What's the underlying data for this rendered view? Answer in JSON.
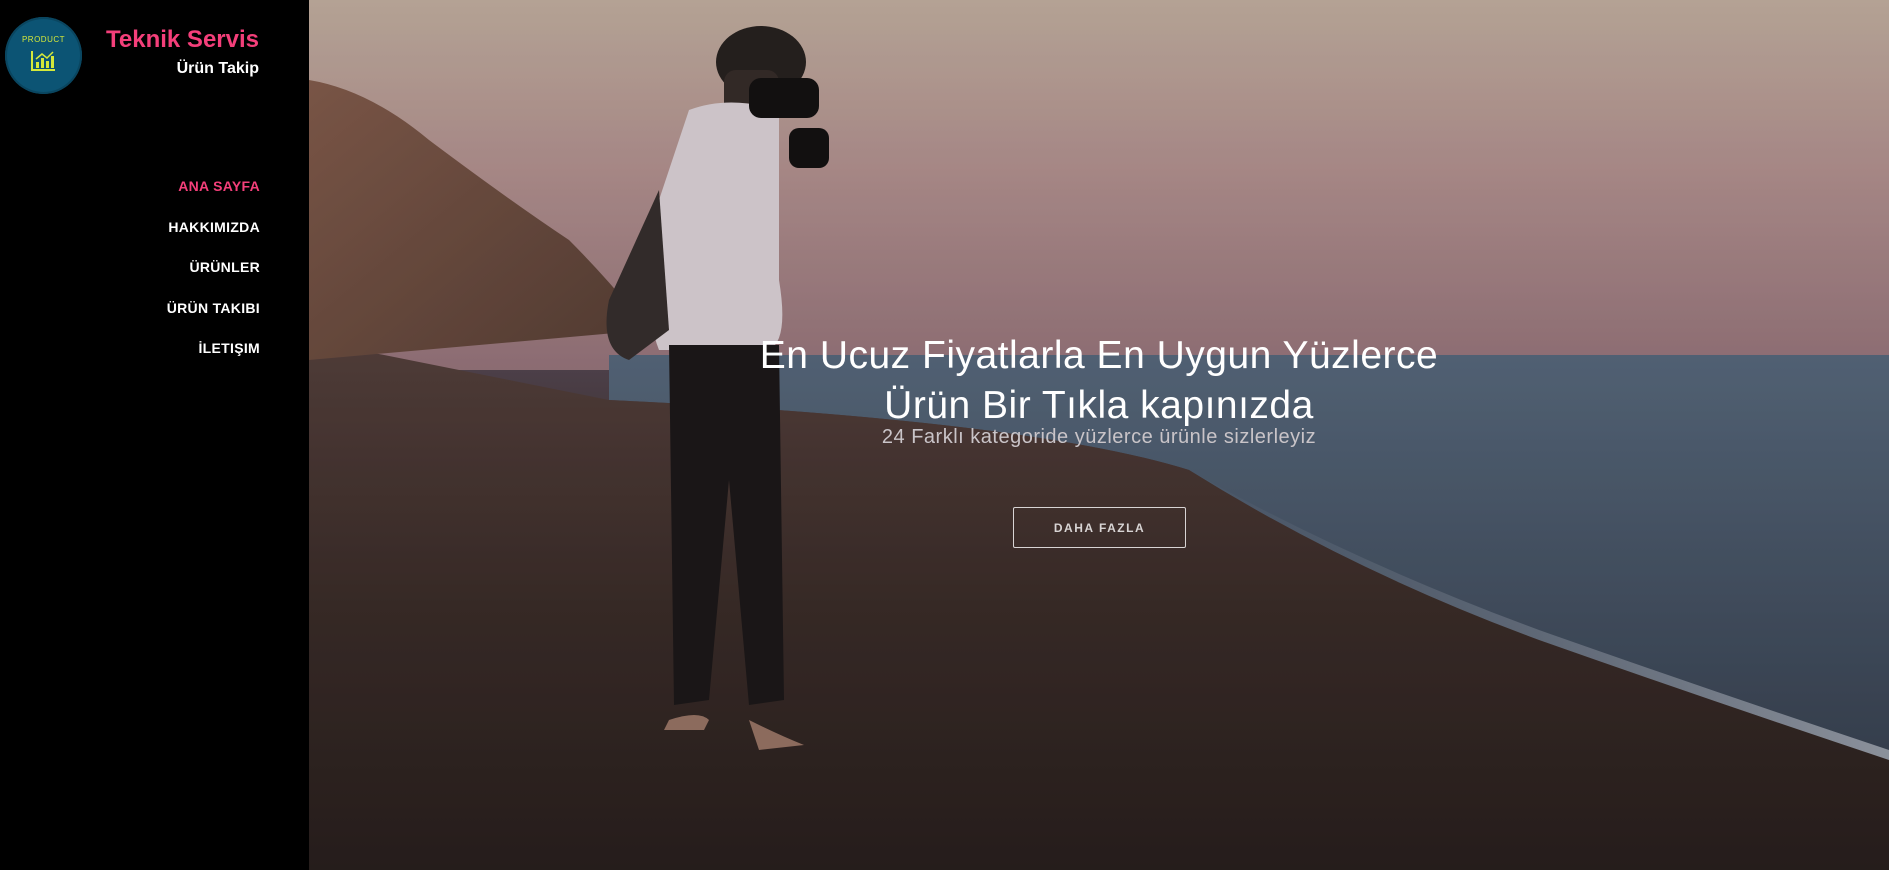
{
  "brand": {
    "badge_text": "PRODUCT",
    "badge_icon": "bar-chart-icon",
    "title": "Teknik Servis",
    "subtitle": "Ürün Takip"
  },
  "nav": {
    "items": [
      {
        "label": "ANA SAYFA",
        "active": true
      },
      {
        "label": "HAKKIMIZDA",
        "active": false
      },
      {
        "label": "ÜRÜNLER",
        "active": false
      },
      {
        "label": "ÜRÜN TAKIBI",
        "active": false
      },
      {
        "label": "İLETIŞIM",
        "active": false
      }
    ]
  },
  "hero": {
    "title_line1": "En Ucuz Fiyatlarla En Uygun Yüzlerce",
    "title_line2": "Ürün Bir Tıkla kapınızda",
    "subtitle": "24 Farklı kategoride yüzlerce ürünle sizlerleyiz",
    "button_label": "DAHA FAZLA",
    "image": "photographer-on-beach-at-sunset"
  },
  "colors": {
    "accent": "#f43f7a",
    "sidebar_bg": "#000000",
    "badge_bg": "#0c5474",
    "badge_fg": "#d4e83a"
  }
}
